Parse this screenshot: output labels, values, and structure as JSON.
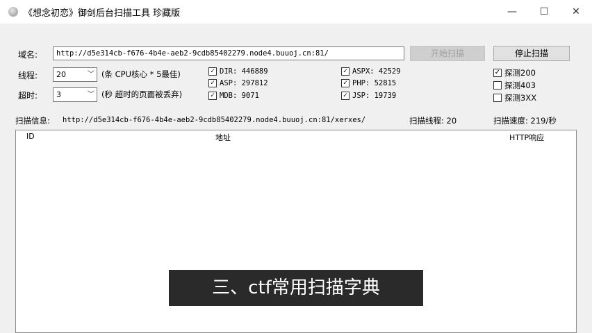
{
  "window": {
    "title": "《想念初恋》御剑后台扫描工具 珍藏版",
    "minimize_glyph": "—",
    "maximize_glyph": "☐",
    "close_glyph": "✕"
  },
  "form": {
    "domain_label": "域名:",
    "domain_value": "http://d5e314cb-f676-4b4e-aeb2-9cdb85402279.node4.buuoj.cn:81/",
    "start_button": "开始扫描",
    "stop_button": "停止扫描",
    "threads_label": "线程:",
    "threads_value": "20",
    "threads_hint": "(条 CPU核心 * 5最佳)",
    "timeout_label": "超时:",
    "timeout_value": "3",
    "timeout_hint": "(秒 超时的页面被丢弃)"
  },
  "dictionaries": [
    {
      "label": "DIR: 446889",
      "checked": true
    },
    {
      "label": "ASP: 297812",
      "checked": true
    },
    {
      "label": "MDB: 9071",
      "checked": true
    },
    {
      "label": "ASPX: 42529",
      "checked": true
    },
    {
      "label": "PHP: 52815",
      "checked": true
    },
    {
      "label": "JSP: 19739",
      "checked": true
    }
  ],
  "probes": [
    {
      "label": "探测200",
      "checked": true
    },
    {
      "label": "探测403",
      "checked": false
    },
    {
      "label": "探测3XX",
      "checked": false
    }
  ],
  "status": {
    "info_label": "扫描信息:",
    "info_value": "http://d5e314cb-f676-4b4e-aeb2-9cdb85402279.node4.buuoj.cn:81/xerxes/",
    "threads_text": "扫描线程: 20",
    "speed_text": "扫描速度: 219/秒"
  },
  "results": {
    "columns": [
      "ID",
      "地址",
      "HTTP响应"
    ]
  },
  "caption": "三、ctf常用扫描字典"
}
